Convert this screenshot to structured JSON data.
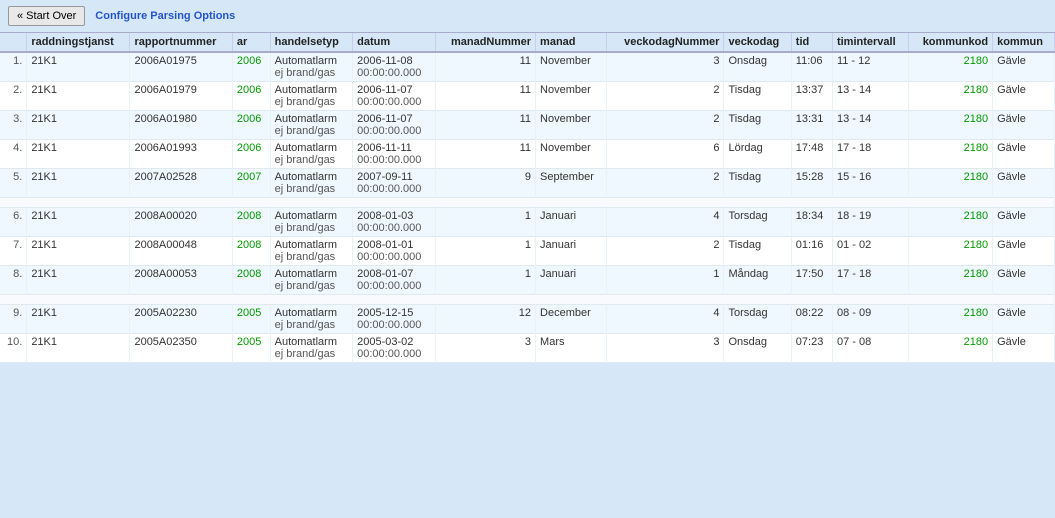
{
  "toolbar": {
    "start_over_label": "« Start Over",
    "configure_label": "Configure Parsing Options"
  },
  "table": {
    "headers": [
      {
        "key": "rownum",
        "label": ""
      },
      {
        "key": "raddningstjanst",
        "label": "raddningstjanst"
      },
      {
        "key": "rapportnummer",
        "label": "rapportnummer"
      },
      {
        "key": "ar",
        "label": "ar"
      },
      {
        "key": "handelsetyp",
        "label": "handelsetyp"
      },
      {
        "key": "datum",
        "label": "datum"
      },
      {
        "key": "manadNummer",
        "label": "manadNummer"
      },
      {
        "key": "manad",
        "label": "manad"
      },
      {
        "key": "veckodagNummer",
        "label": "veckodagNummer"
      },
      {
        "key": "veckodag",
        "label": "veckodag"
      },
      {
        "key": "tid",
        "label": "tid"
      },
      {
        "key": "timintervall",
        "label": "timintervall"
      },
      {
        "key": "kommunkod",
        "label": "kommunkod"
      },
      {
        "key": "kommun",
        "label": "kommun"
      }
    ],
    "rows": [
      {
        "rownum": "1.",
        "raddningstjanst": "21K1",
        "rapportnummer": "2006A01975",
        "ar": "2006",
        "handelsetyp": "Automatlarm\nej brand/gas",
        "datum": "2006-11-08\n00:00:00.000",
        "manadNummer": "11",
        "manad": "November",
        "veckodagNummer": "3",
        "veckodag": "Onsdag",
        "tid": "11:06",
        "timintervall": "11 - 12",
        "kommunkod": "2180",
        "kommun": "Gävle"
      },
      {
        "rownum": "2.",
        "raddningstjanst": "21K1",
        "rapportnummer": "2006A01979",
        "ar": "2006",
        "handelsetyp": "Automatlarm\nej brand/gas",
        "datum": "2006-11-07\n00:00:00.000",
        "manadNummer": "11",
        "manad": "November",
        "veckodagNummer": "2",
        "veckodag": "Tisdag",
        "tid": "13:37",
        "timintervall": "13 - 14",
        "kommunkod": "2180",
        "kommun": "Gävle"
      },
      {
        "rownum": "3.",
        "raddningstjanst": "21K1",
        "rapportnummer": "2006A01980",
        "ar": "2006",
        "handelsetyp": "Automatlarm\nej brand/gas",
        "datum": "2006-11-07\n00:00:00.000",
        "manadNummer": "11",
        "manad": "November",
        "veckodagNummer": "2",
        "veckodag": "Tisdag",
        "tid": "13:31",
        "timintervall": "13 - 14",
        "kommunkod": "2180",
        "kommun": "Gävle"
      },
      {
        "rownum": "4.",
        "raddningstjanst": "21K1",
        "rapportnummer": "2006A01993",
        "ar": "2006",
        "handelsetyp": "Automatlarm\nej brand/gas",
        "datum": "2006-11-11\n00:00:00.000",
        "manadNummer": "11",
        "manad": "November",
        "veckodagNummer": "6",
        "veckodag": "Lördag",
        "tid": "17:48",
        "timintervall": "17 - 18",
        "kommunkod": "2180",
        "kommun": "Gävle"
      },
      {
        "rownum": "5.",
        "raddningstjanst": "21K1",
        "rapportnummer": "2007A02528",
        "ar": "2007",
        "handelsetyp": "Automatlarm\nej brand/gas",
        "datum": "2007-09-11\n00:00:00.000",
        "manadNummer": "9",
        "manad": "September",
        "veckodagNummer": "2",
        "veckodag": "Tisdag",
        "tid": "15:28",
        "timintervall": "15 - 16",
        "kommunkod": "2180",
        "kommun": "Gävle"
      },
      {
        "rownum": "6.",
        "raddningstjanst": "21K1",
        "rapportnummer": "2008A00020",
        "ar": "2008",
        "handelsetyp": "Automatlarm\nej brand/gas",
        "datum": "2008-01-03\n00:00:00.000",
        "manadNummer": "1",
        "manad": "Januari",
        "veckodagNummer": "4",
        "veckodag": "Torsdag",
        "tid": "18:34",
        "timintervall": "18 - 19",
        "kommunkod": "2180",
        "kommun": "Gävle"
      },
      {
        "rownum": "7.",
        "raddningstjanst": "21K1",
        "rapportnummer": "2008A00048",
        "ar": "2008",
        "handelsetyp": "Automatlarm\nej brand/gas",
        "datum": "2008-01-01\n00:00:00.000",
        "manadNummer": "1",
        "manad": "Januari",
        "veckodagNummer": "2",
        "veckodag": "Tisdag",
        "tid": "01:16",
        "timintervall": "01 - 02",
        "kommunkod": "2180",
        "kommun": "Gävle"
      },
      {
        "rownum": "8.",
        "raddningstjanst": "21K1",
        "rapportnummer": "2008A00053",
        "ar": "2008",
        "handelsetyp": "Automatlarm\nej brand/gas",
        "datum": "2008-01-07\n00:00:00.000",
        "manadNummer": "1",
        "manad": "Januari",
        "veckodagNummer": "1",
        "veckodag": "Måndag",
        "tid": "17:50",
        "timintervall": "17 - 18",
        "kommunkod": "2180",
        "kommun": "Gävle"
      },
      {
        "rownum": "9.",
        "raddningstjanst": "21K1",
        "rapportnummer": "2005A02230",
        "ar": "2005",
        "handelsetyp": "Automatlarm\nej brand/gas",
        "datum": "2005-12-15\n00:00:00.000",
        "manadNummer": "12",
        "manad": "December",
        "veckodagNummer": "4",
        "veckodag": "Torsdag",
        "tid": "08:22",
        "timintervall": "08 - 09",
        "kommunkod": "2180",
        "kommun": "Gävle"
      },
      {
        "rownum": "10.",
        "raddningstjanst": "21K1",
        "rapportnummer": "2005A02350",
        "ar": "2005",
        "handelsetyp": "Automatlarm\nej brand/gas",
        "datum": "2005-03-02\n00:00:00.000",
        "manadNummer": "3",
        "manad": "Mars",
        "veckodagNummer": "3",
        "veckodag": "Onsdag",
        "tid": "07:23",
        "timintervall": "07 - 08",
        "kommunkod": "2180",
        "kommun": "Gävle"
      }
    ]
  }
}
